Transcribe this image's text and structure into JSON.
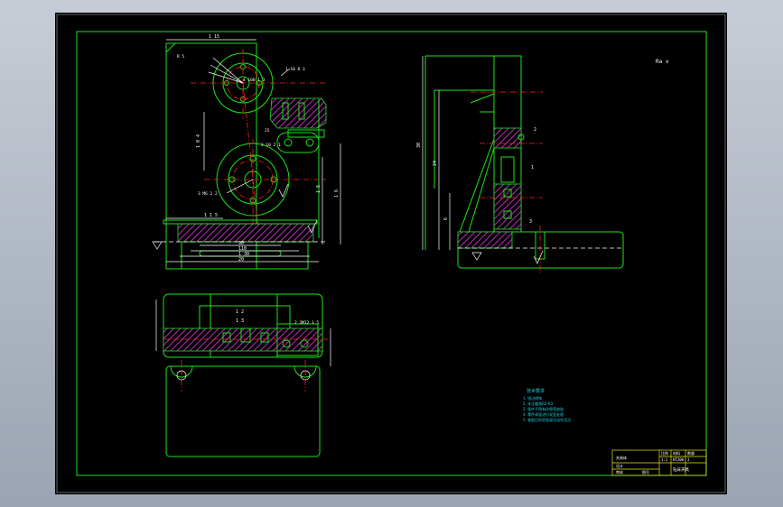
{
  "colors": {
    "background": "#000000",
    "frame": "#19e619",
    "section": "#b02ab0",
    "centerline": "#ff2020",
    "dimension": "#ffffff",
    "cyan": "#18d0e0"
  },
  "front_view": {
    "dims": {
      "top_width": "1 15",
      "vertical_1": "1 0 4",
      "height_total": "1 6",
      "height_right": "1 6",
      "base_width_1": "90",
      "base_width_2": "110",
      "base_width_3": "1 30",
      "base_width_4": "20",
      "left_offset": "1 1 5"
    },
    "callouts": {
      "c1": "4 100 1 3",
      "c2": "1 10 0 3",
      "c3": "25",
      "c4": "2 10 2 1",
      "c5": "3 M6 1 2",
      "c6": "R 5"
    }
  },
  "side_view": {
    "dims": {
      "overall_height": "30",
      "d1": "24",
      "d2": "6",
      "d3": "1",
      "d4": "2",
      "d5": "3"
    }
  },
  "top_view": {
    "dims": {
      "b1": "1 2",
      "b2": "1 3",
      "b3": "2 3M12 1 5"
    }
  },
  "notes": {
    "roughness": "Ra ∨"
  },
  "tech_requirements": {
    "title": "技术要求",
    "lines": [
      "1. 锐边倒钝",
      "2. 未注圆角R2-R3",
      "3. 铸件不得有砂眼等缺陷",
      "4. 零件表面进行发蓝处理",
      "5. 装配后检验各部位动作灵活"
    ]
  },
  "title_block": {
    "cells": [
      "夹具体",
      "比例",
      "1:1",
      "材料",
      "HT200",
      "数量",
      "1",
      "钻床夹具",
      "设计",
      "审核",
      "图号"
    ]
  }
}
